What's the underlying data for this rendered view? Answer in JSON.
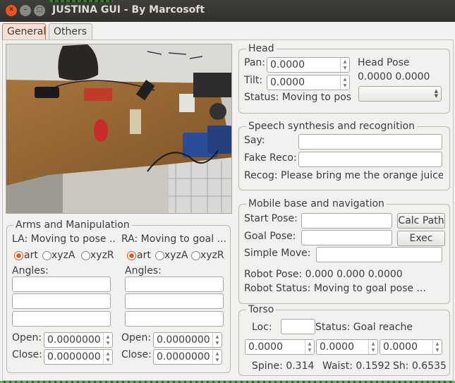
{
  "window": {
    "title": "JUSTINA GUI - By Marcosoft"
  },
  "tabs": [
    {
      "label": "General"
    },
    {
      "label": "Others"
    }
  ],
  "head": {
    "title": "Head",
    "pan_label": "Pan:",
    "pan_value": "0.0000",
    "tilt_label": "Tilt:",
    "tilt_value": "0.0000",
    "status": "Status: Moving to pose",
    "pose_label": "Head Pose",
    "pose_value": "0.0000  0.0000"
  },
  "speech": {
    "title": "Speech synthesis and recognition",
    "say_label": "Say:",
    "say_value": "",
    "fake_reco_label": "Fake Reco:",
    "fake_reco_value": "",
    "recog_text": "Recog: Please bring me the orange juice f"
  },
  "mobile_base": {
    "title": "Mobile base and navigation",
    "start_pose_label": "Start Pose:",
    "calc_path_label": "Calc Path",
    "goal_pose_label": "Goal Pose:",
    "exec_path_label": "Exec Path",
    "simple_move_label": "Simple Move:",
    "robot_pose": "Robot Pose: 0.000  0.000  0.0000",
    "robot_status": "Robot Status: Moving to goal pose ..."
  },
  "torso": {
    "title": "Torso",
    "loc_label": "Loc:",
    "status": "Status: Goal reache",
    "spins": [
      "0.0000",
      "0.0000",
      "0.0000"
    ],
    "spine": "Spine: 0.314",
    "waist": "Waist: 0.1592",
    "shoulder": "Sh: 0.6535"
  },
  "arms": {
    "title": "Arms and Manipulation",
    "left": {
      "status": "LA: Moving to pose ..",
      "radios": [
        "art",
        "xyzA",
        "xyzR"
      ],
      "selected": "art",
      "angles_label": "Angles:",
      "open_label": "Open:",
      "open_value": "0.0000000",
      "close_label": "Close:",
      "close_value": "0.0000000"
    },
    "right": {
      "status": "RA: Moving to goal ...",
      "radios": [
        "art",
        "xyzA",
        "xyzR"
      ],
      "selected": "art",
      "angles_label": "Angles:",
      "open_label": "Open:",
      "open_value": "0.0000000",
      "close_label": "Close:",
      "close_value": "0.0000000"
    }
  },
  "colors": {
    "accent": "#e95420",
    "titlebar": "#3c3b37",
    "window_bg": "#f2f1f0"
  }
}
